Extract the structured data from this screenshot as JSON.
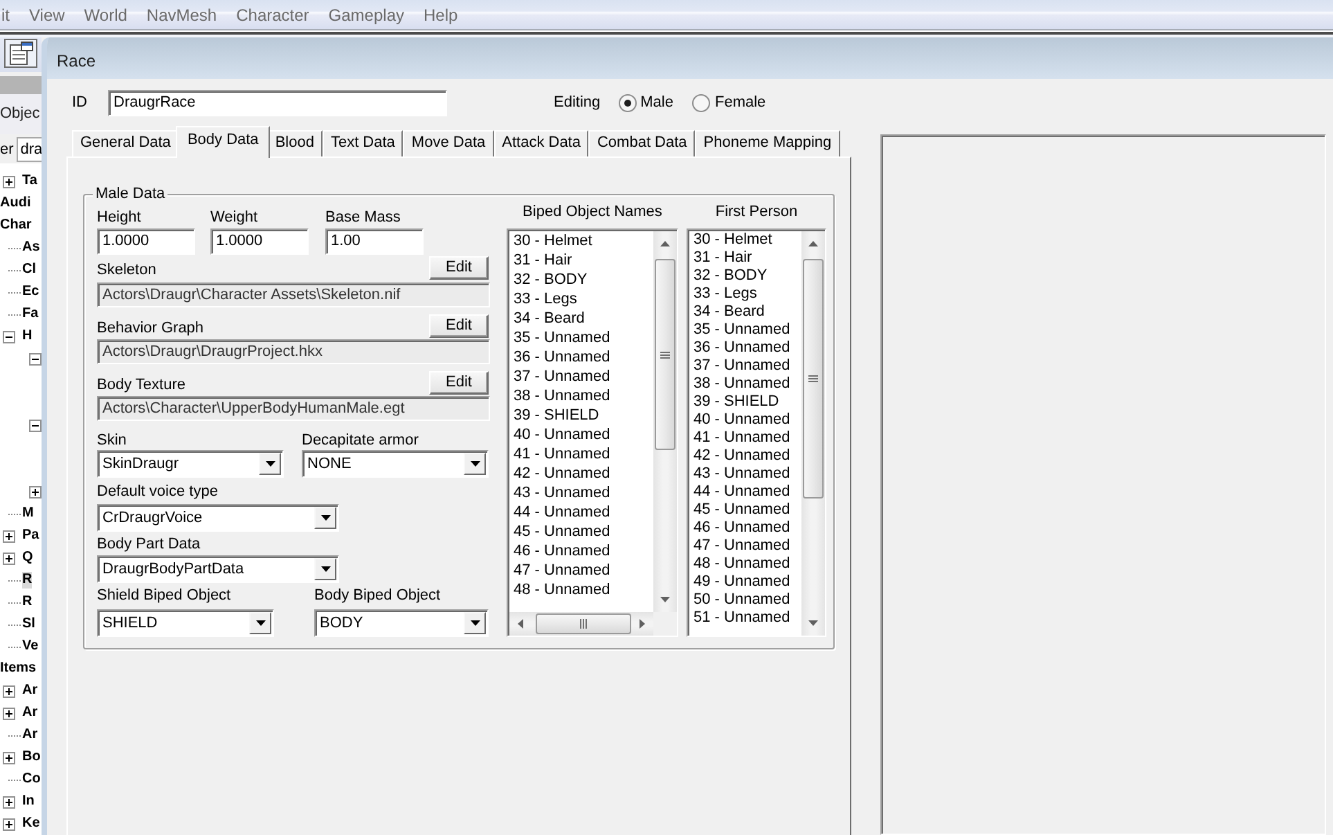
{
  "menu_bar": {
    "items": [
      "it",
      "View",
      "World",
      "NavMesh",
      "Character",
      "Gameplay",
      "Help"
    ]
  },
  "object_window": {
    "title": "Objec",
    "filter": {
      "label": "er",
      "value": "dra"
    },
    "tree": [
      {
        "children": [
          {
            "label": "Ta",
            "expanded": false,
            "selected": false
          }
        ]
      },
      {
        "label": "Audi",
        "selected": false
      },
      {
        "label": "Char",
        "selected": false,
        "children": [
          {
            "label": "As",
            "selected": false
          },
          {
            "label": "Cl",
            "selected": false
          },
          {
            "label": "Ec",
            "selected": false
          },
          {
            "label": "Fa",
            "selected": false
          },
          {
            "label": "H",
            "expanded": true,
            "selected": false,
            "children": [
              {
                "expanded": true
              },
              {
                "expanded": true
              },
              {
                "expanded": false
              }
            ]
          },
          {
            "label": "M",
            "selected": false
          },
          {
            "label": "Pa",
            "expanded": false,
            "selected": false
          },
          {
            "label": "Q",
            "expanded": false,
            "selected": false
          },
          {
            "label": "R",
            "selected": true
          },
          {
            "label": "R",
            "selected": false
          },
          {
            "label": "Sl",
            "selected": false
          },
          {
            "label": "Ve",
            "selected": false
          }
        ]
      },
      {
        "label": "Items",
        "selected": false,
        "children": [
          {
            "label": "Ar",
            "expanded": false,
            "selected": false
          },
          {
            "label": "Ar",
            "expanded": false,
            "selected": false
          },
          {
            "label": "Ar",
            "selected": false
          },
          {
            "label": "Bo",
            "expanded": false,
            "selected": false
          },
          {
            "label": "Co",
            "selected": false
          },
          {
            "label": "In",
            "expanded": false,
            "selected": false
          },
          {
            "label": "Ke",
            "expanded": false,
            "selected": false
          }
        ]
      }
    ]
  },
  "race_window": {
    "title": "Race",
    "id_field": {
      "label": "ID",
      "value": "DraugrRace"
    },
    "editing": {
      "label": "Editing",
      "options": [
        {
          "label": "Male",
          "selected": true
        },
        {
          "label": "Female",
          "selected": false
        }
      ]
    },
    "tabs": [
      {
        "label": "General Data",
        "selected": false
      },
      {
        "label": "Body Data",
        "selected": true
      },
      {
        "label": "Blood",
        "selected": false
      },
      {
        "label": "Text Data",
        "selected": false
      },
      {
        "label": "Move Data",
        "selected": false
      },
      {
        "label": "Attack Data",
        "selected": false
      },
      {
        "label": "Combat Data",
        "selected": false
      },
      {
        "label": "Phoneme Mapping",
        "selected": false
      }
    ],
    "male_data": {
      "title": "Male Data",
      "scales": [
        {
          "label": "Height",
          "value": "1.0000"
        },
        {
          "label": "Weight",
          "value": "1.0000"
        },
        {
          "label": "Base Mass",
          "value": "1.00"
        }
      ],
      "files": [
        {
          "label": "Skeleton",
          "button": "Edit",
          "path": "Actors\\Draugr\\Character Assets\\Skeleton.nif"
        },
        {
          "label": "Behavior Graph",
          "button": "Edit",
          "path": "Actors\\Draugr\\DraugrProject.hkx"
        },
        {
          "label": "Body Texture",
          "button": "Edit",
          "path": "Actors\\Character\\UpperBodyHumanMale.egt"
        }
      ],
      "dropdown_rows": [
        [
          {
            "label": "Skin",
            "value": "SkinDraugr"
          },
          {
            "label": "Decapitate armor",
            "value": "NONE"
          }
        ],
        [
          {
            "label": "Default voice type",
            "value": "CrDraugrVoice"
          }
        ],
        [
          {
            "label": "Body Part Data",
            "value": "DraugrBodyPartData"
          }
        ],
        [
          {
            "label": "Shield Biped Object",
            "value": "SHIELD"
          },
          {
            "label": "Body Biped Object",
            "value": "BODY"
          }
        ]
      ],
      "lists": [
        {
          "title": "Biped Object Names",
          "items": [
            {
              "label": "30 - Helmet",
              "selected": false
            },
            {
              "label": "31 - Hair",
              "selected": false
            },
            {
              "label": "32 - BODY",
              "selected": false
            },
            {
              "label": "33 - Legs",
              "selected": false
            },
            {
              "label": "34 - Beard",
              "selected": false
            },
            {
              "label": "35 - Unnamed",
              "selected": false
            },
            {
              "label": "36 - Unnamed",
              "selected": false
            },
            {
              "label": "37 - Unnamed",
              "selected": false
            },
            {
              "label": "38 - Unnamed",
              "selected": false
            },
            {
              "label": "39 - SHIELD",
              "selected": false
            },
            {
              "label": "40 - Unnamed",
              "selected": false
            },
            {
              "label": "41 - Unnamed",
              "selected": false
            },
            {
              "label": "42 - Unnamed",
              "selected": false
            },
            {
              "label": "43 - Unnamed",
              "selected": false
            },
            {
              "label": "44 - Unnamed",
              "selected": false
            },
            {
              "label": "45 - Unnamed",
              "selected": false
            },
            {
              "label": "46 - Unnamed",
              "selected": false
            },
            {
              "label": "47 - Unnamed",
              "selected": false
            },
            {
              "label": "48 - Unnamed",
              "selected": false
            }
          ]
        },
        {
          "title": "First Person",
          "items": [
            {
              "label": "30 - Helmet",
              "selected": false
            },
            {
              "label": "31 - Hair",
              "selected": false
            },
            {
              "label": "32 - BODY",
              "selected": false
            },
            {
              "label": "33 - Legs",
              "selected": false
            },
            {
              "label": "34 - Beard",
              "selected": false
            },
            {
              "label": "35 - Unnamed",
              "selected": false
            },
            {
              "label": "36 - Unnamed",
              "selected": false
            },
            {
              "label": "37 - Unnamed",
              "selected": false
            },
            {
              "label": "38 - Unnamed",
              "selected": false
            },
            {
              "label": "39 - SHIELD",
              "selected": false
            },
            {
              "label": "40 - Unnamed",
              "selected": false
            },
            {
              "label": "41 - Unnamed",
              "selected": false
            },
            {
              "label": "42 - Unnamed",
              "selected": false
            },
            {
              "label": "43 - Unnamed",
              "selected": false
            },
            {
              "label": "44 - Unnamed",
              "selected": false
            },
            {
              "label": "45 - Unnamed",
              "selected": false
            },
            {
              "label": "46 - Unnamed",
              "selected": false
            },
            {
              "label": "47 - Unnamed",
              "selected": false
            },
            {
              "label": "48 - Unnamed",
              "selected": false
            },
            {
              "label": "49 - Unnamed",
              "selected": false
            },
            {
              "label": "50 - Unnamed",
              "selected": false
            },
            {
              "label": "51 - Unnamed",
              "selected": false
            }
          ]
        }
      ]
    }
  }
}
